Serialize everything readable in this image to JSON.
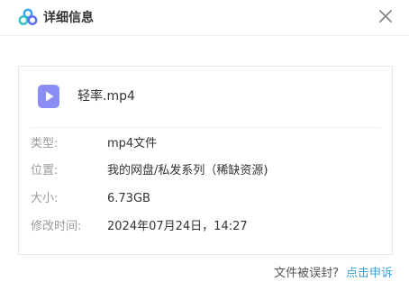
{
  "dialog": {
    "title": "详细信息",
    "logo_icon": "cloud-logo-icon",
    "close_icon": "close-icon"
  },
  "file": {
    "icon": "video-file-icon",
    "icon_color": "#8c8cf5",
    "name": "轻率.mp4"
  },
  "details": {
    "type": {
      "label": "类型:",
      "value": "mp4文件"
    },
    "location": {
      "label": "位置:",
      "value": "我的网盘/私发系列（稀缺资源)"
    },
    "size": {
      "label": "大小:",
      "value": "6.73GB"
    },
    "modified": {
      "label": "修改时间:",
      "value": "2024年07月24日，14:27"
    }
  },
  "footer": {
    "question": "文件被误封?",
    "appeal_link": "点击申诉",
    "link_color": "#3aa0d8"
  }
}
